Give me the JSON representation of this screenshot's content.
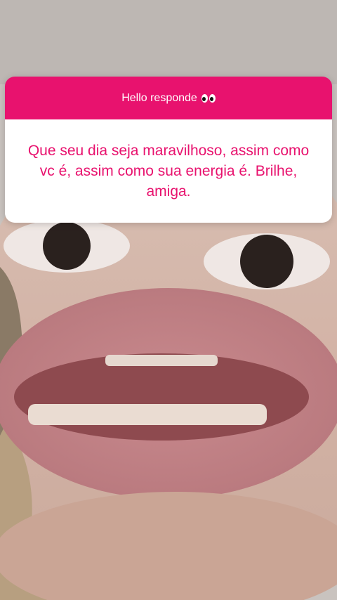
{
  "theme": {
    "accent": "#E8126E",
    "question_text_color": "#E8126E",
    "card_background": "#FFFFFF"
  },
  "question_sticker": {
    "title": "Hello responde",
    "title_icon": "eyes-icon",
    "answer": "Que seu dia seja maravilhoso, assim como vc é, assim como sua energia é. Brilhe, amiga."
  },
  "background": {
    "type": "photo",
    "icon": "face-photo"
  }
}
